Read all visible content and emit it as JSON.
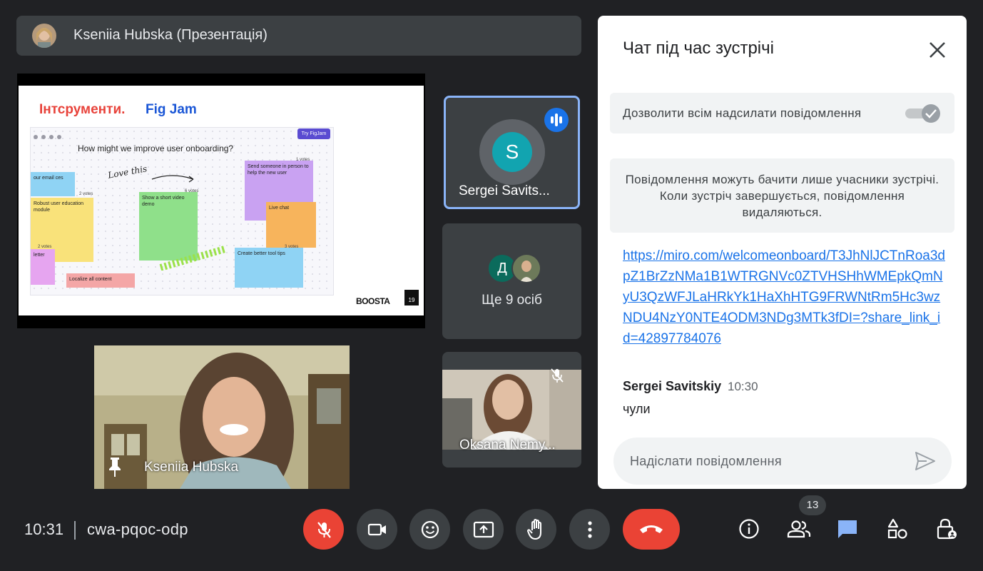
{
  "presenter": {
    "name": "Kseniia Hubska (Презентація)"
  },
  "slide": {
    "title_part1": "Інтсрументи.",
    "title_part2": "Fig Jam",
    "board_question": "How might we improve user onboarding?",
    "try_button": "Try FigJam",
    "annotation": "Love this",
    "stickies": [
      "our email ces",
      "Robust user education module",
      "Show a short video demo",
      "Send someone in person to help the new user",
      "Live chat",
      "Create better tool tips",
      "letter",
      "Localize all content"
    ],
    "votes": [
      "1 votes",
      "2 votes",
      "6 votes",
      "2 votes",
      "3 votes"
    ],
    "logo": "BOOSTA",
    "logo_number": "19"
  },
  "tiles": {
    "sergei": {
      "initial": "S",
      "name": "Sergei Savits..."
    },
    "more": {
      "initial": "Д",
      "label": "Ще 9 осіб"
    },
    "oksana": {
      "name": "Oksana Nemy..."
    },
    "self": {
      "name": "Kseniia Hubska"
    }
  },
  "chat": {
    "title": "Чат під час зустрічі",
    "allow_label": "Дозволити всім надсилати повідомлення",
    "allow_enabled": true,
    "info": "Повідомлення можуть бачити лише учасники зустрічі. Коли зустріч завершується, повідомлення видаляються.",
    "link": "https://miro.com/welcomeonboard/T3JhNlJCTnRoa3dpZ1BrZzNMa1B1WTRGNVc0ZTVHSHhWMEpkQmNyU3QzWFJLaHRkYk1HaXhHTG9FRWNtRm5Hc3wzNDU4NzY0NTE4ODM3NDg3MTk3fDI=?share_link_id=42897784076",
    "message": {
      "sender": "Sergei Savitskiy",
      "time": "10:30",
      "text": "чули"
    },
    "input_placeholder": "Надіслати повідомлення"
  },
  "bottom_bar": {
    "time": "10:31",
    "meeting_code": "cwa-pqoc-odp",
    "participants_count": "13"
  },
  "colors": {
    "background": "#202124",
    "tile": "#3c4043",
    "danger": "#ea4335",
    "accent": "#8ab4f8",
    "link": "#1a73e8"
  },
  "icons": [
    "mic-off-icon",
    "camera-icon",
    "emoji-icon",
    "present-icon",
    "raise-hand-icon",
    "more-vert-icon",
    "call-end-icon",
    "info-icon",
    "people-icon",
    "chat-icon",
    "activities-icon",
    "host-controls-icon",
    "close-icon",
    "send-icon",
    "pin-icon",
    "speaking-icon",
    "check-icon"
  ]
}
